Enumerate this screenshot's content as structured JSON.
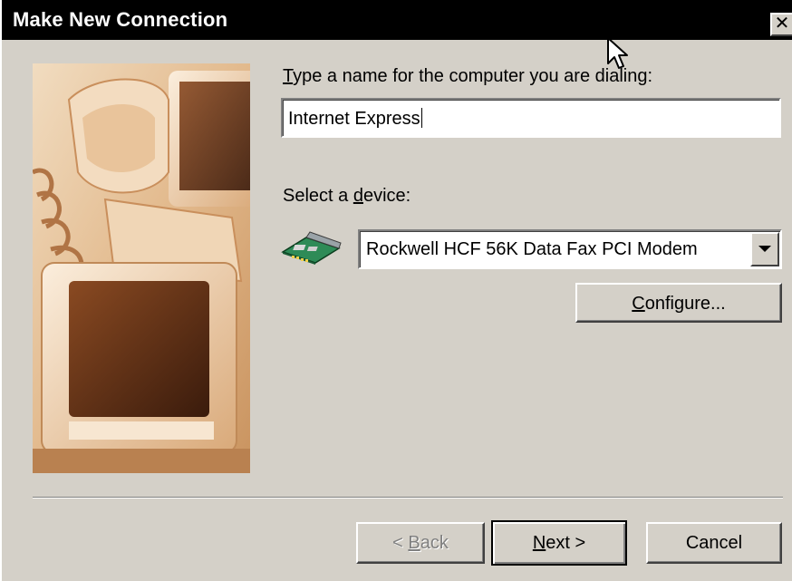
{
  "window": {
    "title": "Make New Connection",
    "close_glyph": "✕"
  },
  "form": {
    "name_label_accel": "T",
    "name_label_rest": "ype a name for the computer you are dialing:",
    "name_value": "Internet Express",
    "device_label_pre": "Select a ",
    "device_label_accel": "d",
    "device_label_post": "evice:",
    "device_icon": "modem-card-icon",
    "device_value": "Rockwell HCF 56K Data Fax PCI Modem",
    "configure_accel": "C",
    "configure_rest": "onfigure..."
  },
  "buttons": {
    "back_pre": "< ",
    "back_accel": "B",
    "back_rest": "ack",
    "next_accel": "N",
    "next_rest": "ext >",
    "cancel": "Cancel"
  },
  "colors": {
    "dialog_face": "#d4d0c8",
    "titlebar": "#000000",
    "picture_tone": "#e8c9a4"
  }
}
